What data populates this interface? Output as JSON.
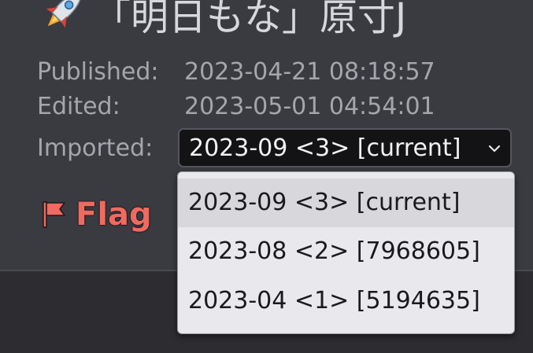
{
  "header": {
    "title": "「明日もな」原寸J",
    "icon": "rocket-icon"
  },
  "meta": {
    "published_label": "Published:",
    "published_value": "2023-04-21 08:18:57",
    "edited_label": "Edited:",
    "edited_value": "2023-05-01 04:54:01",
    "imported_label": "Imported:"
  },
  "imported_select": {
    "selected": "2023-09 <3> [current]",
    "options": [
      {
        "label": "2023-09 <3> [current]"
      },
      {
        "label": "2023-08 <2> [7968605]"
      },
      {
        "label": "2023-04 <1> [5194635]"
      }
    ]
  },
  "flag": {
    "label": "Flag",
    "icon": "flag-icon",
    "color": "#ef6a60"
  }
}
